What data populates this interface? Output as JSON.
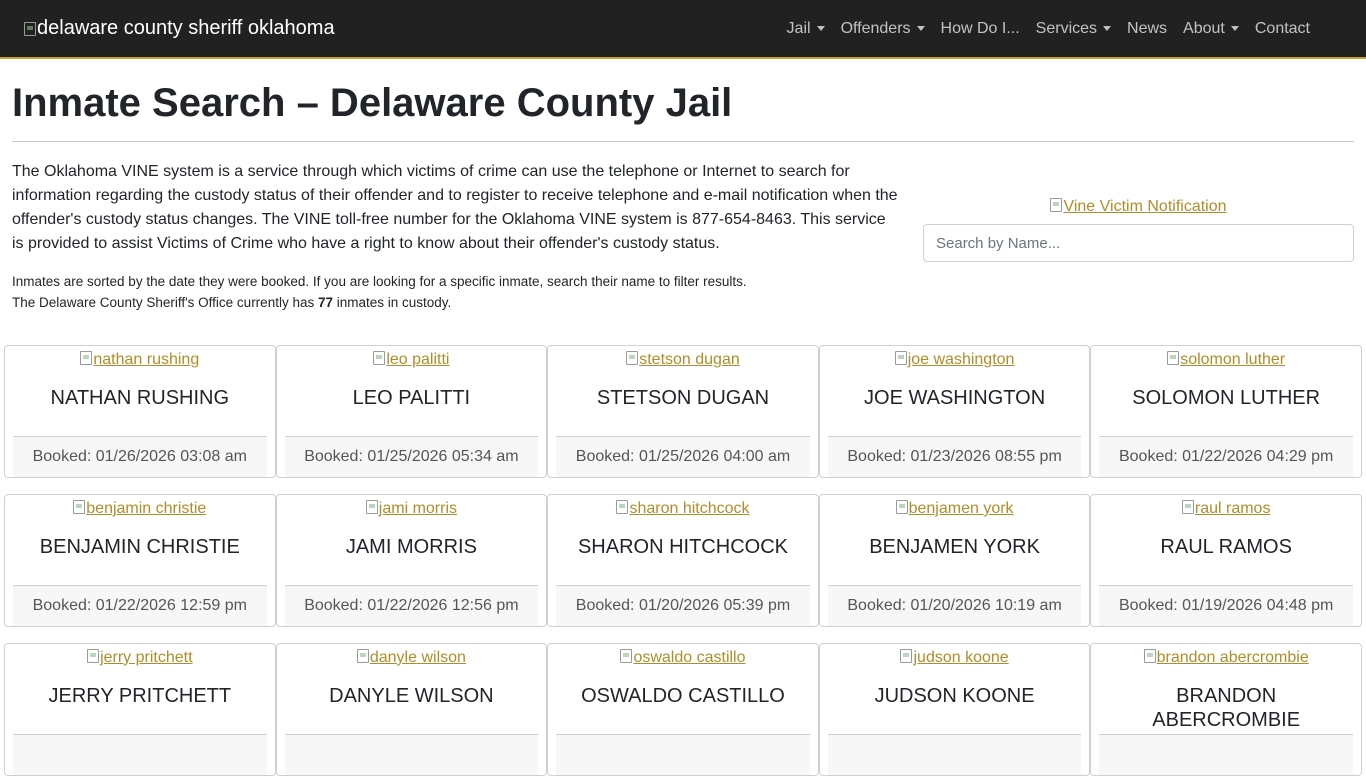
{
  "navbar": {
    "brand_alt": "delaware county sheriff oklahoma",
    "items": [
      {
        "label": "Jail",
        "dropdown": true
      },
      {
        "label": "Offenders",
        "dropdown": true
      },
      {
        "label": "How Do I...",
        "dropdown": false
      },
      {
        "label": "Services",
        "dropdown": true
      },
      {
        "label": "News",
        "dropdown": false
      },
      {
        "label": "About",
        "dropdown": true
      },
      {
        "label": "Contact",
        "dropdown": false
      }
    ]
  },
  "page": {
    "title": "Inmate Search – Delaware County Jail",
    "intro": "The Oklahoma VINE system is a service through which victims of crime can use the telephone or Internet to search for information regarding the custody status of their offender and to register to receive telephone and e-mail notification when the offender's custody status changes. The VINE toll-free number for the Oklahoma VINE system is 877-654-8463. This service is provided to assist Victims of Crime who have a right to know about their offender's custody status.",
    "note_line1": "Inmates are sorted by the date they were booked. If you are looking for a specific inmate, search their name to filter results.",
    "note_line2_prefix": "The Delaware County Sheriff's Office currently has ",
    "inmate_count": "77",
    "note_line2_suffix": " inmates in custody.",
    "vine_link": "Vine Victim Notification",
    "search_placeholder": "Search by Name..."
  },
  "inmates": [
    {
      "photo_alt": "nathan rushing",
      "name": "NATHAN RUSHING",
      "booked": "Booked: 01/26/2026 03:08 am"
    },
    {
      "photo_alt": "leo palitti",
      "name": "LEO PALITTI",
      "booked": "Booked: 01/25/2026 05:34 am"
    },
    {
      "photo_alt": "stetson dugan",
      "name": "STETSON DUGAN",
      "booked": "Booked: 01/25/2026 04:00 am"
    },
    {
      "photo_alt": "joe washington",
      "name": "JOE WASHINGTON",
      "booked": "Booked: 01/23/2026 08:55 pm"
    },
    {
      "photo_alt": "solomon luther",
      "name": "SOLOMON LUTHER",
      "booked": "Booked: 01/22/2026 04:29 pm"
    },
    {
      "photo_alt": "benjamin christie",
      "name": "BENJAMIN CHRISTIE",
      "booked": "Booked: 01/22/2026 12:59 pm"
    },
    {
      "photo_alt": "jami morris",
      "name": "JAMI MORRIS",
      "booked": "Booked: 01/22/2026 12:56 pm"
    },
    {
      "photo_alt": "sharon hitchcock",
      "name": "SHARON HITCHCOCK",
      "booked": "Booked: 01/20/2026 05:39 pm"
    },
    {
      "photo_alt": "benjamen york",
      "name": "BENJAMEN YORK",
      "booked": "Booked: 01/20/2026 10:19 am"
    },
    {
      "photo_alt": "raul ramos",
      "name": "RAUL RAMOS",
      "booked": "Booked: 01/19/2026 04:48 pm"
    },
    {
      "photo_alt": "jerry pritchett",
      "name": "JERRY PRITCHETT",
      "booked": ""
    },
    {
      "photo_alt": "danyle wilson",
      "name": "DANYLE WILSON",
      "booked": ""
    },
    {
      "photo_alt": "oswaldo castillo",
      "name": "OSWALDO CASTILLO",
      "booked": ""
    },
    {
      "photo_alt": "judson koone",
      "name": "JUDSON KOONE",
      "booked": ""
    },
    {
      "photo_alt": "brandon abercrombie",
      "name": "BRANDON ABERCROMBIE",
      "booked": ""
    }
  ],
  "colors": {
    "navbar_bg": "#212121",
    "accent_border": "#c9a227",
    "link": "#b08d2a"
  }
}
